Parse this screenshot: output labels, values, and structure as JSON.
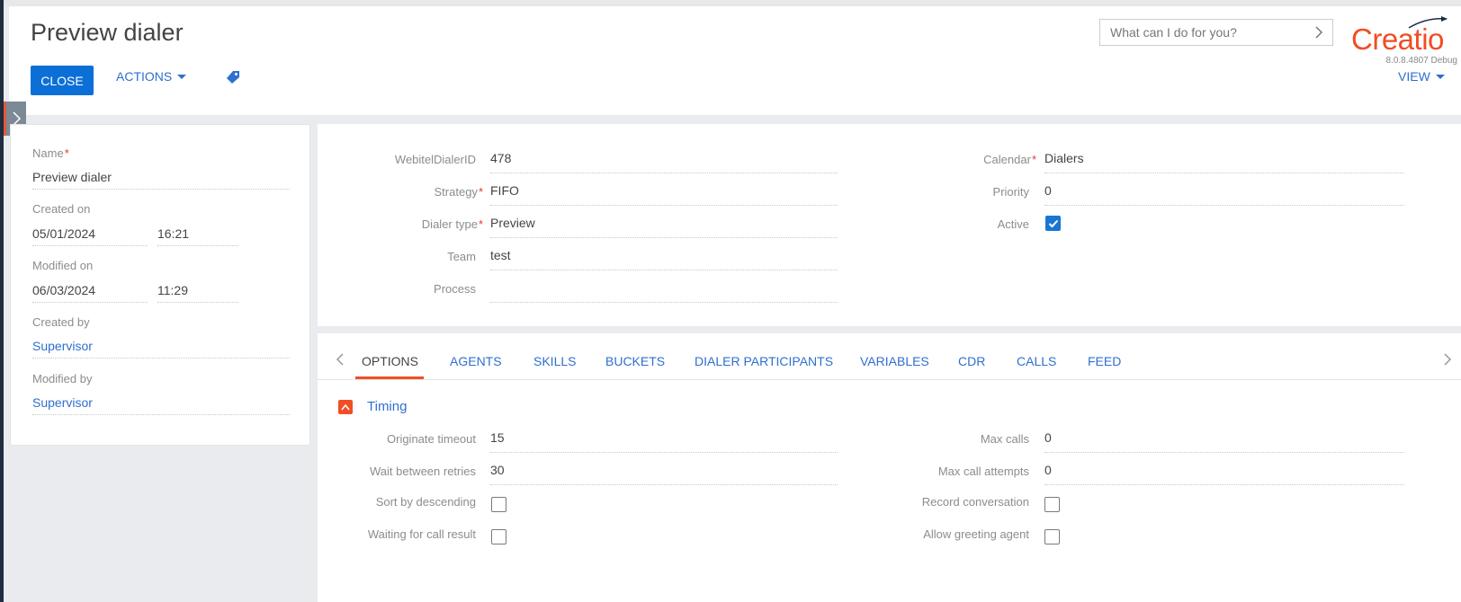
{
  "header": {
    "title": "Preview dialer",
    "close_label": "CLOSE",
    "actions_label": "ACTIONS",
    "search_placeholder": "What can I do for you?",
    "logo_text": "Creatio",
    "version": "8.0.8.4807 Debug",
    "view_label": "VIEW"
  },
  "left_panel": {
    "name_label": "Name",
    "name_value": "Preview dialer",
    "created_on_label": "Created on",
    "created_on_date": "05/01/2024",
    "created_on_time": "16:21",
    "modified_on_label": "Modified on",
    "modified_on_date": "06/03/2024",
    "modified_on_time": "11:29",
    "created_by_label": "Created by",
    "created_by_value": "Supervisor",
    "modified_by_label": "Modified by",
    "modified_by_value": "Supervisor"
  },
  "main_fields": {
    "webitel_label": "WebitelDialerID",
    "webitel_value": "478",
    "strategy_label": "Strategy",
    "strategy_value": "FIFO",
    "dialer_type_label": "Dialer type",
    "dialer_type_value": "Preview",
    "team_label": "Team",
    "team_value": "test",
    "process_label": "Process",
    "process_value": "",
    "calendar_label": "Calendar",
    "calendar_value": "Dialers",
    "priority_label": "Priority",
    "priority_value": "0",
    "active_label": "Active",
    "active_checked": true
  },
  "tabs": [
    {
      "label": "OPTIONS",
      "active": true
    },
    {
      "label": "AGENTS",
      "active": false
    },
    {
      "label": "SKILLS",
      "active": false
    },
    {
      "label": "BUCKETS",
      "active": false
    },
    {
      "label": "DIALER PARTICIPANTS",
      "active": false
    },
    {
      "label": "VARIABLES",
      "active": false
    },
    {
      "label": "CDR",
      "active": false
    },
    {
      "label": "CALLS",
      "active": false
    },
    {
      "label": "FEED",
      "active": false
    }
  ],
  "timing": {
    "title": "Timing",
    "originate_timeout_label": "Originate timeout",
    "originate_timeout_value": "15",
    "wait_between_label": "Wait between retries",
    "wait_between_value": "30",
    "sort_desc_label": "Sort by descending",
    "sort_desc_checked": false,
    "waiting_result_label": "Waiting for call result",
    "waiting_result_checked": false,
    "max_calls_label": "Max calls",
    "max_calls_value": "0",
    "max_attempts_label": "Max call attempts",
    "max_attempts_value": "0",
    "record_label": "Record conversation",
    "record_checked": false,
    "greeting_label": "Allow greeting agent",
    "greeting_checked": false
  },
  "colors": {
    "accent": "#0c6fd8",
    "link": "#2f6fd0",
    "brand": "#f04e23"
  }
}
